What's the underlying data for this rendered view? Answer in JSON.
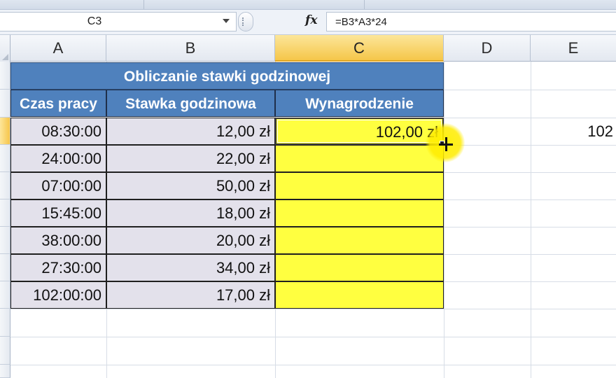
{
  "formula_bar": {
    "name_box": "C3",
    "fx_label": "fx",
    "formula": "=B3*A3*24"
  },
  "columns": [
    "A",
    "B",
    "C",
    "D",
    "E"
  ],
  "active_column": "C",
  "table": {
    "title": "Obliczanie stawki godzinowej",
    "headers": [
      "Czas pracy",
      "Stawka godzinowa",
      "Wynagrodzenie"
    ],
    "rows": [
      {
        "czas": "08:30:00",
        "stawka": "12,00 zł",
        "wynagrodzenie": "102,00 zł"
      },
      {
        "czas": "24:00:00",
        "stawka": "22,00 zł",
        "wynagrodzenie": ""
      },
      {
        "czas": "07:00:00",
        "stawka": "50,00 zł",
        "wynagrodzenie": ""
      },
      {
        "czas": "15:45:00",
        "stawka": "18,00 zł",
        "wynagrodzenie": ""
      },
      {
        "czas": "38:00:00",
        "stawka": "20,00 zł",
        "wynagrodzenie": ""
      },
      {
        "czas": "27:30:00",
        "stawka": "34,00 zł",
        "wynagrodzenie": ""
      },
      {
        "czas": "102:00:00",
        "stawka": "17,00 zł",
        "wynagrodzenie": ""
      }
    ]
  },
  "e_column_value": "102",
  "colors": {
    "header_blue": "#4f81bd",
    "data_grey": "#e3e1eb",
    "result_yellow": "#ffff40",
    "active_header": "#f5c649"
  }
}
